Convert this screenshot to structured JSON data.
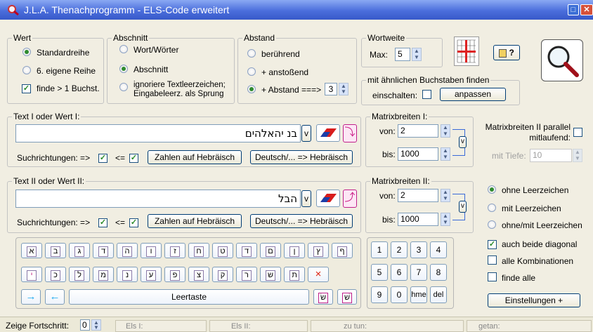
{
  "window": {
    "title": "J.L.A. Thenachprogramm - ELS-Code erweitert"
  },
  "wert": {
    "legend": "Wert",
    "opt1": "Standardreihe",
    "opt2": "6. eigene Reihe",
    "opt3": "finde > 1 Buchst."
  },
  "abschnitt": {
    "legend": "Abschnitt",
    "opt1": "Wort/Wörter",
    "opt2": "Abschnitt",
    "opt3a": "ignoriere Textleerzeichen;",
    "opt3b": "Eingabeleerz. als Sprung"
  },
  "abstand": {
    "legend": "Abstand",
    "opt1": "berührend",
    "opt2": "+ anstoßend",
    "opt3": "+ Abstand ===>",
    "value": "3"
  },
  "wortweite": {
    "legend": "Wortweite",
    "max_label": "Max:",
    "max_value": "5"
  },
  "aehnlich": {
    "legend": "mit ähnlichen Buchstaben finden",
    "einschalten": "einschalten:",
    "anpassen": "anpassen"
  },
  "text1": {
    "legend": "Text I oder Wert I:",
    "value": "בנ יהאלהים",
    "v": "v",
    "suchrichtungen": "Suchrichtungen: =>",
    "back": "<=",
    "zahlen_btn": "Zahlen auf Hebräisch",
    "deutsch_btn": "Deutsch/... => Hebräisch"
  },
  "text2": {
    "legend": "Text II oder Wert II:",
    "value": "הבל",
    "v": "v",
    "suchrichtungen": "Suchrichtungen: =>",
    "back": "<=",
    "zahlen_btn": "Zahlen auf Hebräisch",
    "deutsch_btn": "Deutsch/... => Hebräisch"
  },
  "matrix1": {
    "legend": "Matrixbreiten I:",
    "von_label": "von:",
    "von": "2",
    "bis_label": "bis:",
    "bis": "1000",
    "v": "v"
  },
  "matrix2": {
    "legend": "Matrixbreiten II:",
    "von_label": "von:",
    "von": "2",
    "bis_label": "bis:",
    "bis": "1000",
    "v": "v"
  },
  "parallel": {
    "line1": "Matrixbreiten II parallel",
    "line2": "mitlaufend:",
    "tiefe_label": "mit Tiefe:",
    "tiefe": "10"
  },
  "leer": {
    "opt1": "ohne Leerzeichen",
    "opt2": "mit Leerzeichen",
    "opt3": "ohne/mit Leerzeichen"
  },
  "options": {
    "diag": "auch beide diagonal",
    "kombi": "alle Kombinationen",
    "alle": "finde alle",
    "einstellungen": "Einstellungen +"
  },
  "keyboard": {
    "row1": [
      "א",
      "ב",
      "ג",
      "ד",
      "ה",
      "ו",
      "ז",
      "ח",
      "ט",
      "ד",
      "ם",
      "ן",
      "ץ",
      "ף"
    ],
    "row2": [
      "י",
      "כ",
      "ל",
      "מ",
      "נ",
      "ע",
      "פ",
      "צ",
      "ק",
      "ר",
      "ש",
      "ת",
      "×"
    ],
    "row3": {
      "right": "→",
      "left": "←",
      "space": "Leertaste",
      "k1": "שׂ",
      "k2": "שׁ"
    }
  },
  "numpad": {
    "keys": [
      "1",
      "2",
      "3",
      "4",
      "5",
      "6",
      "7",
      "8",
      "9",
      "0",
      "hme",
      "del"
    ]
  },
  "status": {
    "fortschritt": "Zeige Fortschritt:",
    "fort_value": "0",
    "els1": "Els I:",
    "els2": "Els II:",
    "zutun": "zu tun:",
    "getan": "getan:"
  },
  "colors": {
    "title": "#4b6edc",
    "check": "#2a8a2a",
    "key_pink": "#cc2288"
  }
}
